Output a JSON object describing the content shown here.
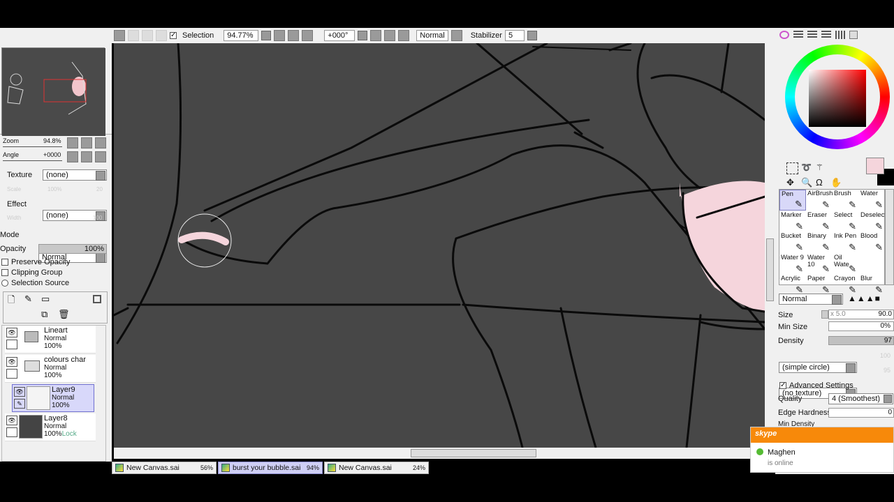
{
  "toolbar": {
    "selection_label": "Selection",
    "selection_checked": true,
    "zoom": "94.77%",
    "angle": "+000°",
    "blend": "Normal",
    "stabilizer_label": "Stabilizer",
    "stabilizer": "5"
  },
  "navigator": {
    "zoom_label": "Zoom",
    "zoom_value": "94.8%",
    "angle_label": "Angle",
    "angle_value": "+0000"
  },
  "layer_props": {
    "texture_label": "Texture",
    "texture_value": "(none)",
    "scale_label": "Scale",
    "scale_value": "100%",
    "scale_num": "20",
    "effect_label": "Effect",
    "effect_value": "(none)",
    "width_label": "Width",
    "width_value": "1",
    "width_num": "100",
    "mode_label": "Mode",
    "mode_value": "Normal",
    "opacity_label": "Opacity",
    "opacity_value": "100%",
    "preserve_opacity": "Preserve Opacity",
    "clipping_group": "Clipping Group",
    "selection_source": "Selection Source"
  },
  "layers": [
    {
      "name": "Lineart",
      "mode": "Normal",
      "opacity": "100%",
      "type": "folder"
    },
    {
      "name": "colours char",
      "mode": "Normal",
      "opacity": "100%",
      "type": "folder"
    },
    {
      "name": "Layer9",
      "mode": "Normal",
      "opacity": "100%",
      "type": "layer",
      "selected": true
    },
    {
      "name": "Layer8",
      "mode": "Normal",
      "opacity": "100%",
      "lock": "Lock",
      "type": "layer"
    }
  ],
  "tools": [
    {
      "label": "Pen",
      "active": true
    },
    {
      "label": "AirBrush"
    },
    {
      "label": "Brush"
    },
    {
      "label": "Water"
    },
    {
      "label": "Marker"
    },
    {
      "label": "Eraser"
    },
    {
      "label": "Select"
    },
    {
      "label": "Deselect"
    },
    {
      "label": "Bucket"
    },
    {
      "label": "Binary"
    },
    {
      "label": "Ink Pen"
    },
    {
      "label": "Blood"
    },
    {
      "label": "Water 9"
    },
    {
      "label": "Water 10"
    },
    {
      "label": "Oil Wate"
    },
    {
      "label": ""
    },
    {
      "label": "Acrylic"
    },
    {
      "label": "Paper"
    },
    {
      "label": "Crayon"
    },
    {
      "label": "Blur"
    }
  ],
  "brush": {
    "blend": "Normal",
    "size_label": "Size",
    "size_mult": "x 5.0",
    "size_value": "90.0",
    "min_size_label": "Min Size",
    "min_size_value": "0%",
    "density_label": "Density",
    "density_value": "97",
    "shape": "(simple circle)",
    "shape_num": "100",
    "texture": "(no texture)",
    "texture_num": "95",
    "advanced_label": "Advanced Settings",
    "quality_label": "Quality",
    "quality_value": "4 (Smoothest)",
    "edge_label": "Edge Hardness",
    "edge_value": "0",
    "min_density_label": "Min Density"
  },
  "colors": {
    "primary": "#f5d5dc",
    "secondary": "#000000",
    "canvas": "#474747"
  },
  "tabs": [
    {
      "name": "New Canvas.sai",
      "zoom": "56%"
    },
    {
      "name": "burst your bubble.sai",
      "zoom": "94%",
      "active": true
    },
    {
      "name": "New Canvas.sai",
      "zoom": "24%"
    }
  ],
  "skype": {
    "brand": "skype",
    "contact": "Maghen",
    "status": "is online"
  }
}
